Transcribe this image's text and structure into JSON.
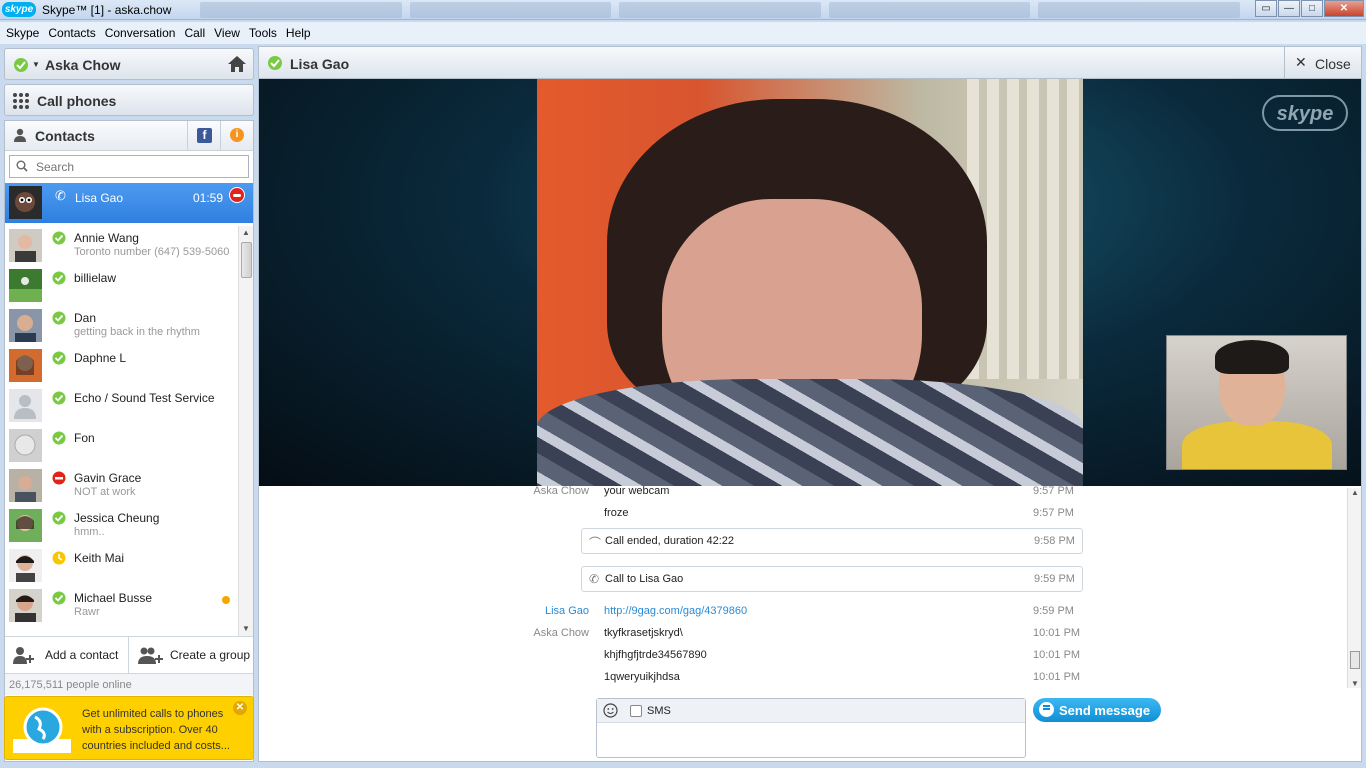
{
  "window": {
    "title": "Skype™ [1] - aska.chow",
    "logo": "skype"
  },
  "menu": [
    "Skype",
    "Contacts",
    "Conversation",
    "Call",
    "View",
    "Tools",
    "Help"
  ],
  "user": {
    "name": "Aska Chow",
    "status_color": "#7ac943"
  },
  "call_phones_label": "Call phones",
  "contacts": {
    "header": "Contacts",
    "search_placeholder": "Search",
    "active_call": {
      "name": "Lisa Gao",
      "duration": "01:59"
    },
    "list": [
      {
        "name": "Annie Wang",
        "mood": "Toronto number (647) 539-5060",
        "status": "online"
      },
      {
        "name": "billielaw",
        "mood": "",
        "status": "online"
      },
      {
        "name": "Dan",
        "mood": "getting back in the rhythm",
        "status": "online"
      },
      {
        "name": "Daphne L",
        "mood": "",
        "status": "online"
      },
      {
        "name": "Echo / Sound Test Service",
        "mood": "",
        "status": "online"
      },
      {
        "name": "Fon",
        "mood": "",
        "status": "online"
      },
      {
        "name": "Gavin Grace",
        "mood": "NOT at work",
        "status": "busy"
      },
      {
        "name": "Jessica Cheung",
        "mood": "hmm..",
        "status": "online"
      },
      {
        "name": "Keith Mai",
        "mood": "",
        "status": "away"
      },
      {
        "name": "Michael Busse",
        "mood": "Rawr",
        "status": "online"
      }
    ],
    "add_contact_label": "Add a contact",
    "create_group_label": "Create a group",
    "online_count": "26,175,511 people online"
  },
  "promo": {
    "text": "Get unlimited calls to phones with a subscription. Over 40 countries included and costs..."
  },
  "conversation": {
    "contact_name": "Lisa Gao",
    "close_label": "Close",
    "messages": [
      {
        "kind": "msg",
        "sender": "Aska Chow",
        "text": "your webcam",
        "time": "9:57 PM"
      },
      {
        "kind": "msg",
        "sender": "",
        "text": "froze",
        "time": "9:57 PM"
      },
      {
        "kind": "event",
        "icon": "hangup",
        "text": "Call ended, duration 42:22",
        "time": "9:58 PM"
      },
      {
        "kind": "event",
        "icon": "phone",
        "text": "Call to Lisa Gao",
        "time": "9:59 PM"
      },
      {
        "kind": "msg",
        "sender": "Lisa Gao",
        "text": "http://9gag.com/gag/4379860",
        "time": "9:59 PM",
        "link": true
      },
      {
        "kind": "msg",
        "sender": "Aska Chow",
        "text": "tkyfkrasetjskryd\\",
        "time": "10:01 PM"
      },
      {
        "kind": "msg",
        "sender": "",
        "text": "khjfhgfjtrde34567890",
        "time": "10:01 PM"
      },
      {
        "kind": "msg",
        "sender": "",
        "text": "1qweryuikjhdsa",
        "time": "10:01 PM"
      }
    ],
    "compose": {
      "sms_label": "SMS",
      "value": ""
    },
    "send_label": "Send message"
  },
  "colors": {
    "accent": "#00aff0",
    "online": "#7ac943",
    "busy": "#e2231a",
    "away": "#f7c600",
    "selection": "#3a88e8",
    "promo": "#ffd000"
  }
}
